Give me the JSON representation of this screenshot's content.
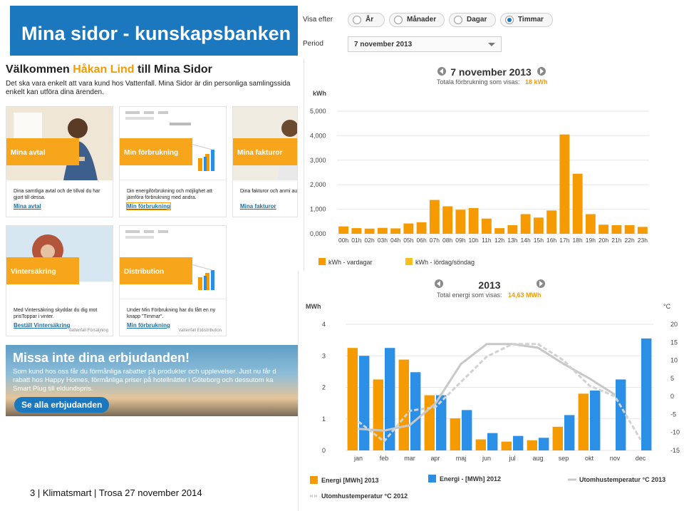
{
  "portal": {
    "banner_title": "Mina sidor - kunskapsbanken",
    "welcome_prefix": "Välkommen ",
    "welcome_name": "Håkan Lind",
    "welcome_suffix": " till Mina Sidor",
    "intro_line1": "Det ska vara enkelt att vara kund hos Vattenfall. Mina Sidor är din personliga samlingssida",
    "intro_line2": "enkelt kan utföra dina ärenden.",
    "cards": [
      {
        "tag": "Mina avtal",
        "desc": "Dina samtliga avtal och de tillval du har gjort till dessa.",
        "link": "Mina avtal",
        "source": ""
      },
      {
        "tag": "Min förbrukning",
        "desc": "Din energiförbrukning och möjlighet att jämföra förbrukning med andra.",
        "link": "Min förbrukning",
        "source": ""
      },
      {
        "tag": "Mina fakturor",
        "desc": "Dina fakturor och anmi autogiro eller e-faktura",
        "link": "Mina fakturor",
        "source": ""
      },
      {
        "tag": "Vintersäkring",
        "desc": "Med Vintersäkring skyddar du dig mot prisToppar i vinter.",
        "link": "Beställ Vintersäkring",
        "source": "Vattenfall Försäljning"
      },
      {
        "tag": "Distribution",
        "desc": "Under Min Förbrukning har du fått en ny knapp \"Timmar\".",
        "link": "Min förbrukning",
        "source": "Vattenfall Eldistribution"
      }
    ],
    "promo": {
      "heading": "Missa inte dina erbjudanden!",
      "text_line1": "Som kund hos oss får du förmånliga rabatter på produkter och upplevelser. Just nu får d",
      "text_line2": "rabatt hos Happy Homes, förmånliga priser på hotellnätter i Göteborg och dessutom ka",
      "text_line3": "Smart Plug till eldundspris.",
      "button": "Se alla erbjudanden"
    }
  },
  "footer": {
    "text": "3  | Klimatsmart |  Trosa 27  november 2014"
  },
  "controls": {
    "view_label": "Visa efter",
    "options": [
      "År",
      "Månader",
      "Dagar",
      "Timmar"
    ],
    "selected": "Timmar",
    "period_label": "Period",
    "period_value": "7 november 2013"
  },
  "colors": {
    "orange": "#f59b00",
    "yellow": "#f7c01d",
    "blue": "#2c8fe6",
    "temp2013": "#c8c8c8",
    "temp2012": "#d2d2d2",
    "banner": "#1b78bf"
  },
  "chart_data": [
    {
      "type": "bar",
      "title": "7 november 2013",
      "subtitle_prefix": "Totala förbrukning som visas:",
      "subtitle_value": "18 kWh",
      "ylabel": "kWh",
      "ylim": [
        0,
        5000
      ],
      "yticks": [
        "0,000",
        "1,000",
        "2,000",
        "3,000",
        "4,000",
        "5,000"
      ],
      "categories": [
        "00h",
        "01h",
        "02h",
        "03h",
        "04h",
        "05h",
        "06h",
        "07h",
        "08h",
        "09h",
        "10h",
        "11h",
        "12h",
        "13h",
        "14h",
        "15h",
        "16h",
        "17h",
        "18h",
        "19h",
        "20h",
        "21h",
        "22h",
        "23h"
      ],
      "series": [
        {
          "name": "kWh - vardagar",
          "values": [
            300,
            230,
            210,
            240,
            220,
            420,
            470,
            1380,
            1120,
            980,
            1050,
            620,
            230,
            350,
            800,
            660,
            950,
            4050,
            2450,
            800,
            370,
            350,
            350,
            280
          ]
        }
      ],
      "legend": [
        "kWh - vardagar",
        "kWh - lördag/söndag"
      ],
      "legend_position": "bottom-left"
    },
    {
      "type": "bar",
      "title": "2013",
      "subtitle_prefix": "Total energi som visas:",
      "subtitle_value": "14,63 MWh",
      "ylabel": "MWh",
      "ylabel_right": "°C",
      "ylim": [
        0,
        4
      ],
      "ylim_right": [
        -15,
        20
      ],
      "yticks": [
        "0",
        "1",
        "2",
        "3",
        "4"
      ],
      "yticks_right": [
        "-15",
        "-10",
        "-5",
        "0",
        "5",
        "10",
        "15",
        "20"
      ],
      "categories": [
        "jan",
        "feb",
        "mar",
        "apr",
        "maj",
        "jun",
        "jul",
        "aug",
        "sep",
        "okt",
        "nov",
        "dec"
      ],
      "series": [
        {
          "name": "Energi [MWh] 2013",
          "values": [
            3.25,
            2.25,
            2.88,
            1.75,
            1.02,
            0.35,
            0.28,
            0.32,
            0.75,
            1.8,
            null,
            null
          ]
        },
        {
          "name": "Energi - [MWh] 2012",
          "values": [
            3.0,
            3.25,
            2.48,
            1.75,
            1.28,
            0.55,
            0.46,
            0.4,
            1.12,
            1.9,
            2.25,
            3.55
          ]
        },
        {
          "name": "Utomhustemperatur °C 2013",
          "values": [
            -9,
            -9.5,
            -8,
            -2,
            9,
            14.5,
            14.5,
            13.5,
            9,
            5,
            0.5,
            null
          ]
        },
        {
          "name": "Utomhustemperatur °C 2012",
          "values": [
            -7,
            -12.5,
            -4,
            -3,
            4,
            11,
            14.5,
            14.5,
            10,
            3,
            0,
            -12
          ]
        }
      ],
      "legend_position": "bottom"
    }
  ]
}
